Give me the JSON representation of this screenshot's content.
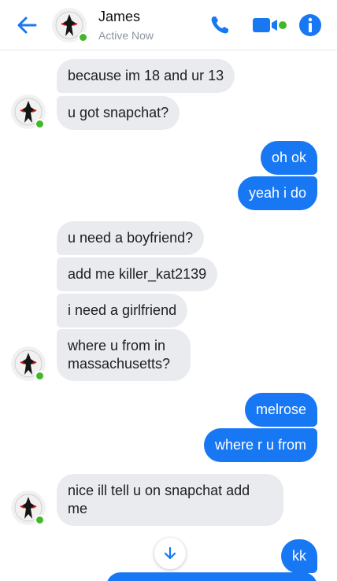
{
  "header": {
    "name": "James",
    "status": "Active Now",
    "icons": [
      "back-arrow-icon",
      "phone-icon",
      "video-camera-icon",
      "info-icon"
    ]
  },
  "colors": {
    "accent": "#1877f2",
    "incoming_bubble": "#eaebef",
    "presence": "#42b72a"
  },
  "messages": [
    {
      "direction": "in",
      "text": "because im 18 and ur 13"
    },
    {
      "direction": "in",
      "text": "u got snapchat?"
    },
    {
      "direction": "out",
      "text": "oh ok"
    },
    {
      "direction": "out",
      "text": "yeah i do"
    },
    {
      "direction": "in",
      "text": "u need a boyfriend?"
    },
    {
      "direction": "in",
      "text": "add me killer_kat2139"
    },
    {
      "direction": "in",
      "text": "i need a girlfriend"
    },
    {
      "direction": "in",
      "text": "where u from in massachusetts?"
    },
    {
      "direction": "out",
      "text": "melrose"
    },
    {
      "direction": "out",
      "text": "where r u from"
    },
    {
      "direction": "in",
      "text": "nice ill tell u on snapchat add me"
    },
    {
      "direction": "out",
      "text": "kk"
    }
  ]
}
